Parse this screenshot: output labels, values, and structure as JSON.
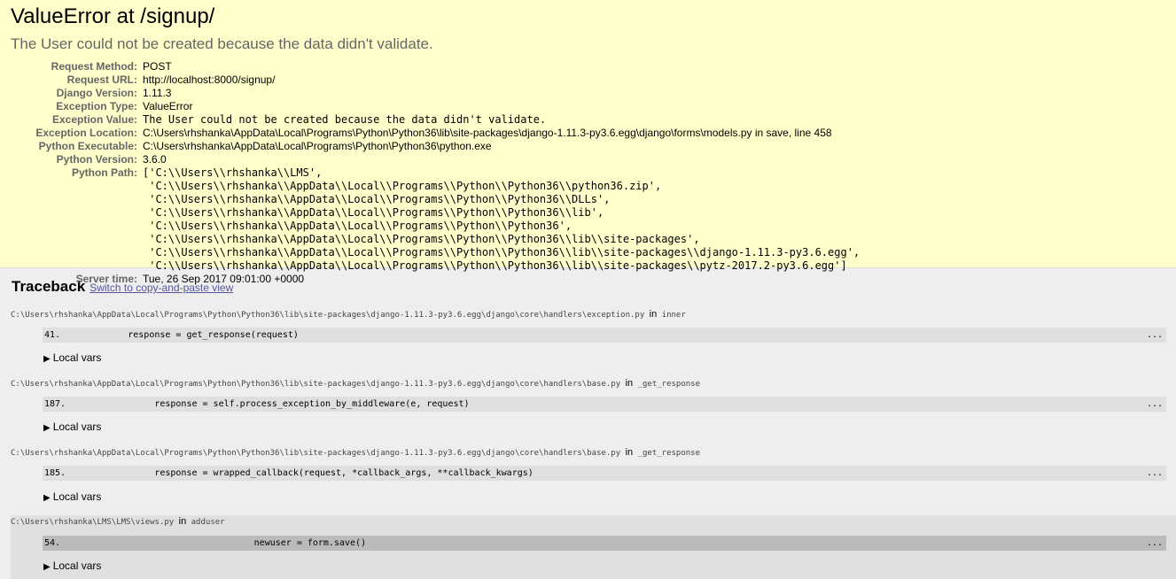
{
  "summary": {
    "title": "ValueError at /signup/",
    "subtitle": "The User could not be created because the data didn't validate.",
    "meta": [
      {
        "label": "Request Method:",
        "value": "POST"
      },
      {
        "label": "Request URL:",
        "value": "http://localhost:8000/signup/"
      },
      {
        "label": "Django Version:",
        "value": "1.11.3"
      },
      {
        "label": "Exception Type:",
        "value": "ValueError"
      },
      {
        "label": "Exception Value:",
        "value": "The User could not be created because the data didn't validate."
      },
      {
        "label": "Exception Location:",
        "value": "C:\\Users\\rhshanka\\AppData\\Local\\Programs\\Python\\Python36\\lib\\site-packages\\django-1.11.3-py3.6.egg\\django\\forms\\models.py in save, line 458"
      },
      {
        "label": "Python Executable:",
        "value": "C:\\Users\\rhshanka\\AppData\\Local\\Programs\\Python\\Python36\\python.exe"
      },
      {
        "label": "Python Version:",
        "value": "3.6.0"
      },
      {
        "label": "Python Path:",
        "value": "['C:\\\\Users\\\\rhshanka\\\\LMS',\n 'C:\\\\Users\\\\rhshanka\\\\AppData\\\\Local\\\\Programs\\\\Python\\\\Python36\\\\python36.zip',\n 'C:\\\\Users\\\\rhshanka\\\\AppData\\\\Local\\\\Programs\\\\Python\\\\Python36\\\\DLLs',\n 'C:\\\\Users\\\\rhshanka\\\\AppData\\\\Local\\\\Programs\\\\Python\\\\Python36\\\\lib',\n 'C:\\\\Users\\\\rhshanka\\\\AppData\\\\Local\\\\Programs\\\\Python\\\\Python36',\n 'C:\\\\Users\\\\rhshanka\\\\AppData\\\\Local\\\\Programs\\\\Python\\\\Python36\\\\lib\\\\site-packages',\n 'C:\\\\Users\\\\rhshanka\\\\AppData\\\\Local\\\\Programs\\\\Python\\\\Python36\\\\lib\\\\site-packages\\\\django-1.11.3-py3.6.egg',\n 'C:\\\\Users\\\\rhshanka\\\\AppData\\\\Local\\\\Programs\\\\Python\\\\Python36\\\\lib\\\\site-packages\\\\pytz-2017.2-py3.6.egg']"
      },
      {
        "label": "Server time:",
        "value": "Tue, 26 Sep 2017 09:01:00 +0000"
      }
    ]
  },
  "traceback": {
    "heading": "Traceback",
    "switch_link": "Switch to copy-and-paste view",
    "in_word": "in",
    "local_vars_label": "Local vars",
    "ellipsis": "...",
    "frames": [
      {
        "path": "C:\\Users\\rhshanka\\AppData\\Local\\Programs\\Python\\Python36\\lib\\site-packages\\django-1.11.3-py3.6.egg\\django\\core\\handlers\\exception.py",
        "func": "inner",
        "lineno": "41.",
        "code": "            response = get_response(request)"
      },
      {
        "path": "C:\\Users\\rhshanka\\AppData\\Local\\Programs\\Python\\Python36\\lib\\site-packages\\django-1.11.3-py3.6.egg\\django\\core\\handlers\\base.py",
        "func": "_get_response",
        "lineno": "187.",
        "code": "                response = self.process_exception_by_middleware(e, request)"
      },
      {
        "path": "C:\\Users\\rhshanka\\AppData\\Local\\Programs\\Python\\Python36\\lib\\site-packages\\django-1.11.3-py3.6.egg\\django\\core\\handlers\\base.py",
        "func": "_get_response",
        "lineno": "185.",
        "code": "                response = wrapped_callback(request, *callback_args, **callback_kwargs)"
      },
      {
        "path": "C:\\Users\\rhshanka\\LMS\\LMS\\views.py",
        "func": "adduser",
        "lineno": "54.",
        "code": "                                newuser = form.save()"
      }
    ]
  }
}
